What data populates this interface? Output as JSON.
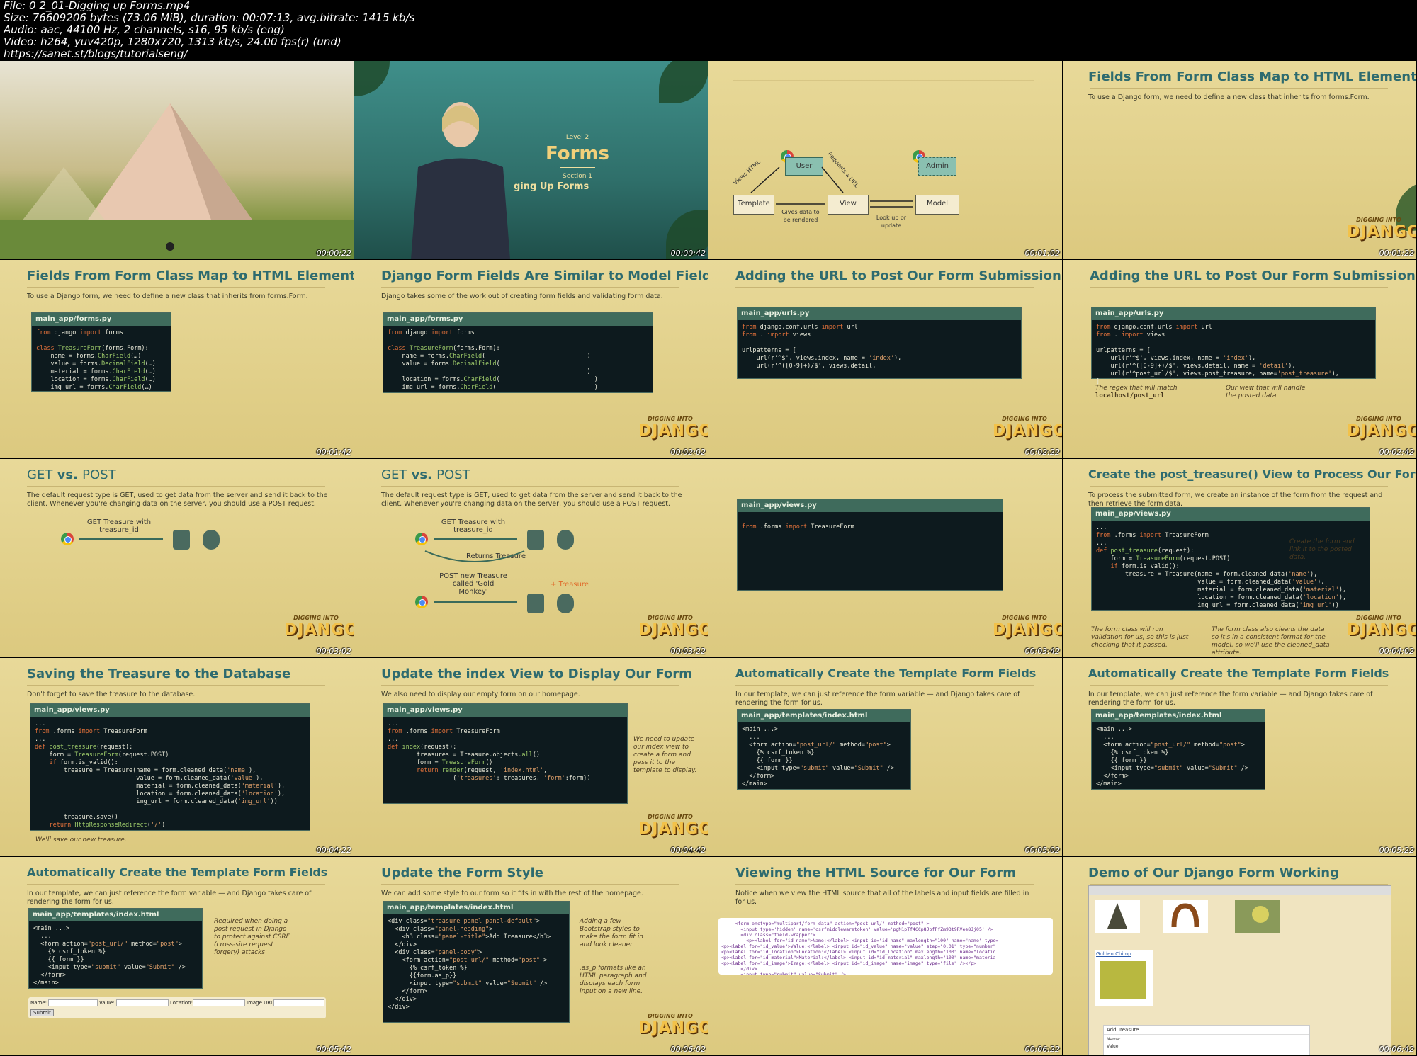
{
  "header": {
    "file": "File: 0 2_01-Digging up Forms.mp4",
    "size": "Size: 76609206 bytes (73.06 MiB), duration: 00:07:13, avg.bitrate: 1415 kb/s",
    "audio": "Audio: aac, 44100 Hz, 2 channels, s16, 95 kb/s (eng)",
    "video": "Video: h264, yuv420p, 1280x720, 1313 kb/s, 24.00 fps(r) (und)",
    "url": "https://sanet.st/blogs/tutorialseng/"
  },
  "logo": {
    "line1": "DIGGING INTO",
    "line2": "DJANGO"
  },
  "tiles": [
    {
      "ts": "00:00:22"
    },
    {
      "ts": "00:00:42",
      "level": "Level 2",
      "forms": "Forms",
      "section": "Section 1",
      "section_title": "ging Up Forms"
    },
    {
      "ts": "00:01:02",
      "user": "User",
      "admin": "Admin",
      "template": "Template",
      "view": "View",
      "model": "Model",
      "views_html": "Views HTML",
      "requests_url": "Requests a URL",
      "gives_data": "Gives data to be rendered",
      "lookup": "Look up or update"
    },
    {
      "ts": "00:01:22",
      "title": "Fields From Form Class Map to HTML Elements",
      "sub": "To use a Django form, we need to define a new class that inherits from forms.Form."
    },
    {
      "ts": "00:01:42",
      "title": "Fields From Form Class Map to HTML Elements",
      "sub": "To use a Django form, we need to define a new class that inherits from forms.Form.",
      "file": "main_app/forms.py"
    },
    {
      "ts": "00:02:02",
      "title": "Django Form Fields Are Similar to Model Fields",
      "sub": "Django takes some of the work out of creating form fields and validating form data.",
      "file": "main_app/forms.py"
    },
    {
      "ts": "00:02:22",
      "title": "Adding the URL to Post Our Form Submission",
      "file": "main_app/urls.py"
    },
    {
      "ts": "00:02:42",
      "title": "Adding the URL to Post Our Form Submission",
      "file": "main_app/urls.py",
      "note1": "The regex that will match",
      "note1b": "localhost/post_url",
      "note2": "Our view that will handle the posted data"
    },
    {
      "ts": "00:03:02",
      "title_a": "GET",
      "title_b": " vs. ",
      "title_c": "POST",
      "sub": "The default request type is GET, used to get data from the server and send it back to the client. Whenever you're changing data on the server, you should use a POST request.",
      "get_label": "GET Treasure with treasure_id"
    },
    {
      "ts": "00:03:22",
      "title_a": "GET",
      "title_b": " vs. ",
      "title_c": "POST",
      "sub": "The default request type is GET, used to get data from the server and send it back to the client. Whenever you're changing data on the server, you should use a POST request.",
      "get_label": "GET Treasure with treasure_id",
      "returns": "Returns Treasure",
      "post_label": "POST new Treasure called 'Gold Monkey'",
      "plus": "+ Treasure"
    },
    {
      "ts": "00:03:42",
      "file": "main_app/views.py"
    },
    {
      "ts": "00:04:02",
      "title": "Create the post_treasure() View to Process Our Form",
      "sub": "To process the submitted form, we create an instance of the form from the request and then retrieve the form data.",
      "file": "main_app/views.py",
      "note1": "Create the form and link it to the posted data.",
      "note2": "The form class will run validation for us, so this is just checking that it passed.",
      "note3": "The form class also cleans the data so it's in a consistent format for the model, so we'll use the cleaned_data attribute."
    },
    {
      "ts": "00:04:22",
      "title": "Saving the Treasure to the Database",
      "sub": "Don't forget to save the treasure to the database.",
      "file": "main_app/views.py",
      "note": "We'll save our new treasure."
    },
    {
      "ts": "00:04:42",
      "title": "Update the index View to Display Our Form",
      "sub": "We also need to display our empty form on our homepage.",
      "file": "main_app/views.py",
      "note": "We need to update our index view to create a form and pass it to the template to display."
    },
    {
      "ts": "00:05:02",
      "title": "Automatically Create the Template Form Fields",
      "sub": "In our template, we can just reference the form variable — and Django takes care of rendering the form for us.",
      "file": "main_app/templates/index.html"
    },
    {
      "ts": "00:05:22",
      "title": "Automatically Create the Template Form Fields",
      "sub": "In our template, we can just reference the form variable — and Django takes care of rendering the form for us.",
      "file": "main_app/templates/index.html"
    },
    {
      "ts": "00:05:42",
      "title": "Automatically Create the Template Form Fields",
      "sub": "In our template, we can just reference the form variable — and Django takes care of rendering the form for us.",
      "file": "main_app/templates/index.html",
      "note": "Required when doing a post request in Django to protect against CSRF (cross-site request forgery) attacks",
      "f1": "Name:",
      "f2": "Value:",
      "f3": "Location:",
      "f4": "Image URL:",
      "submit": "Submit"
    },
    {
      "ts": "00:06:02",
      "title": "Update the Form Style",
      "sub": "We can add some style to our form so it fits in with the rest of the homepage.",
      "file": "main_app/templates/index.html",
      "note1": "Adding a few Bootstrap styles to make the form fit in and look cleaner",
      "note2": ".as_p formats like an HTML paragraph and displays each form input on a new line."
    },
    {
      "ts": "00:06:22",
      "title": "Viewing the HTML Source for Our Form",
      "sub": "Notice when we view the HTML source that all of the labels and input fields are filled in for us."
    },
    {
      "ts": "00:06:42",
      "title": "Demo of Our Django Form Working",
      "golden": "Golden Chimp",
      "add": "Add Treasure",
      "name": "Name:",
      "value": "Value:"
    }
  ]
}
